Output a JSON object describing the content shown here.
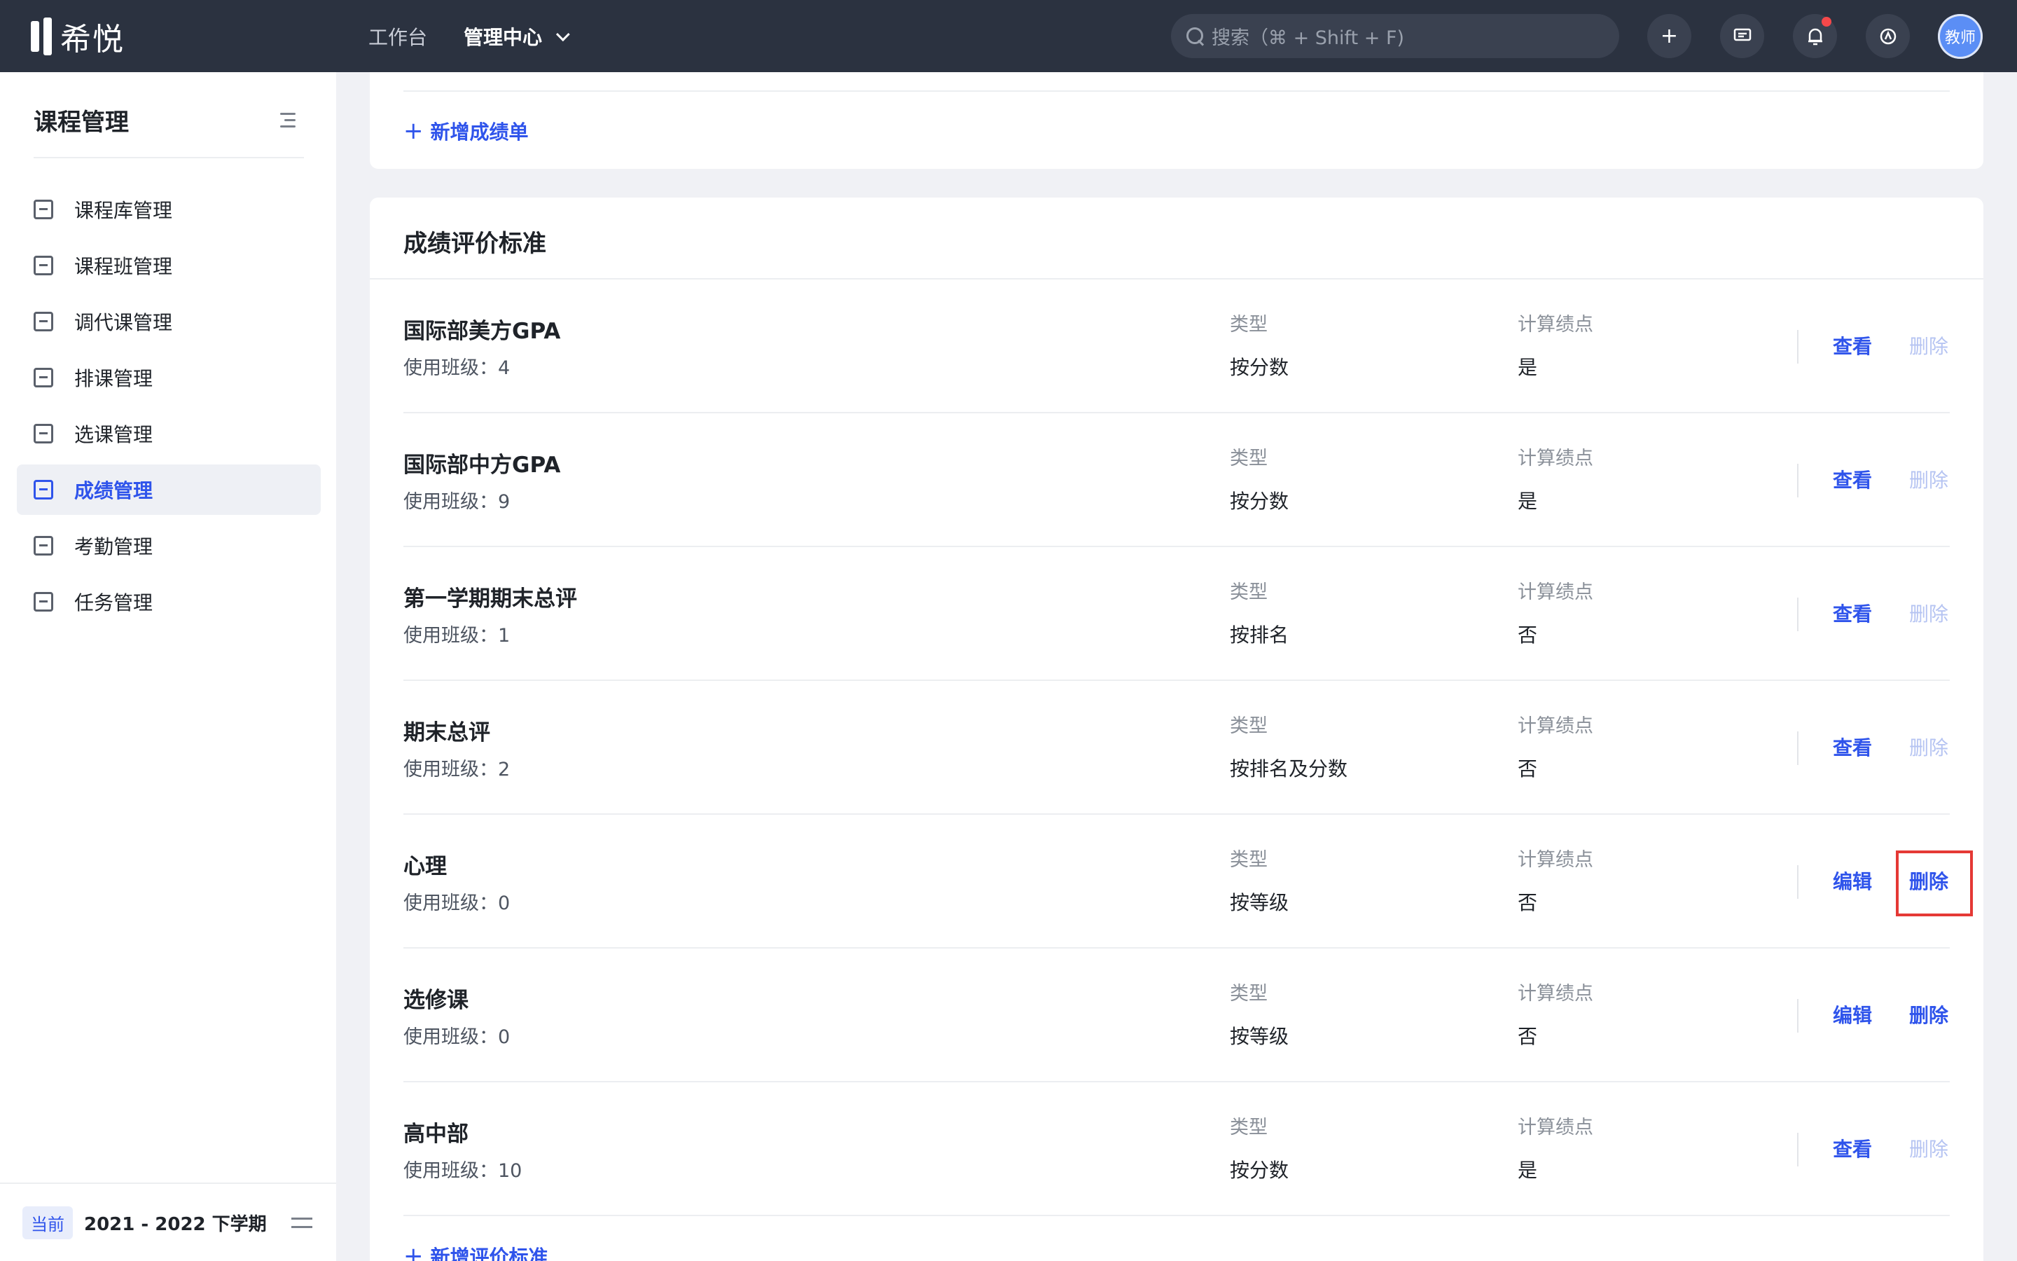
{
  "app": {
    "logo_text": "希悦"
  },
  "topnav": {
    "workbench": "工作台",
    "admin_center": "管理中心"
  },
  "search": {
    "placeholder": "搜索（⌘ + Shift + F)"
  },
  "top_actions": {
    "add_icon": "plus-icon",
    "chat_icon": "message-icon",
    "bell_icon": "bell-icon",
    "help_icon": "compass-icon"
  },
  "avatar": {
    "label": "教师"
  },
  "sidebar": {
    "title": "课程管理",
    "items": [
      {
        "label": "课程库管理",
        "icon": "library-icon",
        "active": false
      },
      {
        "label": "课程班管理",
        "icon": "class-icon",
        "active": false
      },
      {
        "label": "调代课管理",
        "icon": "swap-class-icon",
        "active": false
      },
      {
        "label": "排课管理",
        "icon": "schedule-icon",
        "active": false
      },
      {
        "label": "选课管理",
        "icon": "checkbox-icon",
        "active": false
      },
      {
        "label": "成绩管理",
        "icon": "grade-icon",
        "active": true
      },
      {
        "label": "考勤管理",
        "icon": "calendar-icon",
        "active": false
      },
      {
        "label": "任务管理",
        "icon": "tasklist-icon",
        "active": false
      }
    ],
    "footer": {
      "tag": "当前",
      "term": "2021 - 2022 下学期"
    }
  },
  "top_card": {
    "add_label": "新增成绩单"
  },
  "standards": {
    "title": "成绩评价标准",
    "col_type_label": "类型",
    "col_gpa_label": "计算绩点",
    "usage_prefix": "使用班级：",
    "add_label": "新增评价标准",
    "rows": [
      {
        "name": "国际部美方GPA",
        "usage": "使用班级：4",
        "type": "按分数",
        "gpa": "是",
        "action1": "查看",
        "action2": "删除",
        "action2_enabled": false
      },
      {
        "name": "国际部中方GPA",
        "usage": "使用班级：9",
        "type": "按分数",
        "gpa": "是",
        "action1": "查看",
        "action2": "删除",
        "action2_enabled": false
      },
      {
        "name": "第一学期期末总评",
        "usage": "使用班级：1",
        "type": "按排名",
        "gpa": "否",
        "action1": "查看",
        "action2": "删除",
        "action2_enabled": false
      },
      {
        "name": "期末总评",
        "usage": "使用班级：2",
        "type": "按排名及分数",
        "gpa": "否",
        "action1": "查看",
        "action2": "删除",
        "action2_enabled": false
      },
      {
        "name": "心理",
        "usage": "使用班级：0",
        "type": "按等级",
        "gpa": "否",
        "action1": "编辑",
        "action2": "删除",
        "action2_enabled": true,
        "highlighted": true
      },
      {
        "name": "选修课",
        "usage": "使用班级：0",
        "type": "按等级",
        "gpa": "否",
        "action1": "编辑",
        "action2": "删除",
        "action2_enabled": true
      },
      {
        "name": "高中部",
        "usage": "使用班级：10",
        "type": "按分数",
        "gpa": "是",
        "action1": "查看",
        "action2": "删除",
        "action2_enabled": false
      }
    ]
  }
}
